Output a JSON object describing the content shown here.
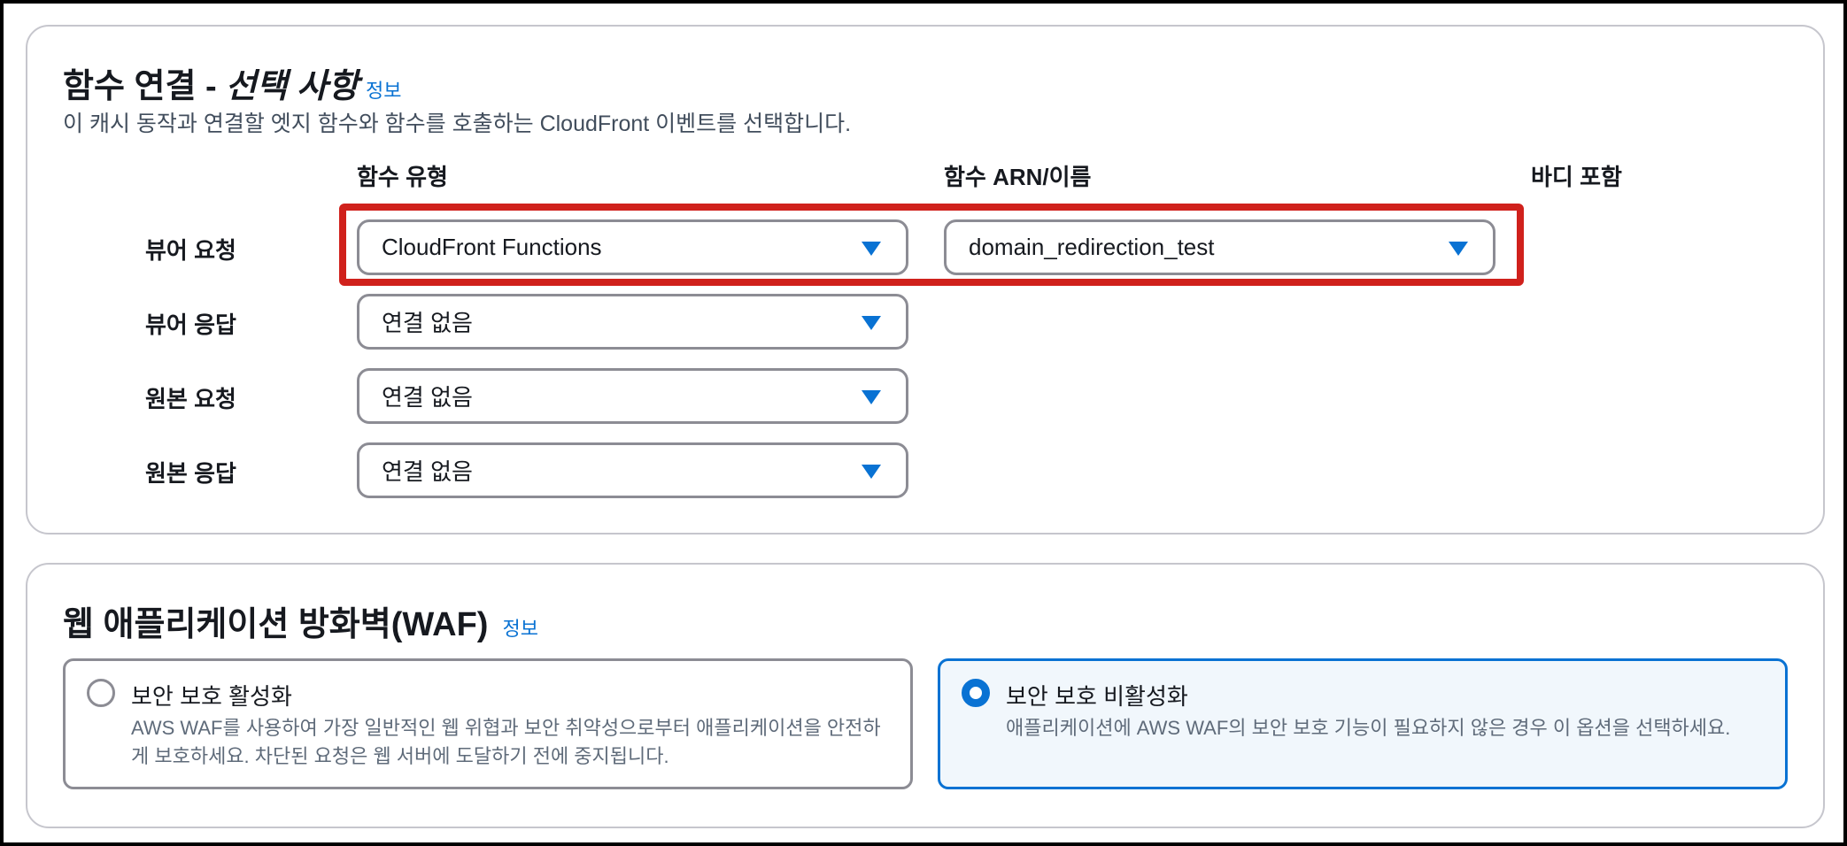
{
  "functions": {
    "title": "함수 연결 - ",
    "title_italic": "선택 사항",
    "info": "정보",
    "description": "이 캐시 동작과 연결할 엣지 함수와 함수를 호출하는 CloudFront 이벤트를 선택합니다.",
    "columns": {
      "type": "함수 유형",
      "arn": "함수 ARN/이름",
      "body": "바디 포함"
    },
    "rows": [
      {
        "label": "뷰어 요청",
        "type_value": "CloudFront Functions",
        "arn_value": "domain_redirection_test"
      },
      {
        "label": "뷰어 응답",
        "type_value": "연결 없음"
      },
      {
        "label": "원본 요청",
        "type_value": "연결 없음"
      },
      {
        "label": "원본 응답",
        "type_value": "연결 없음"
      }
    ]
  },
  "waf": {
    "title": "웹 애플리케이션 방화벽(WAF)",
    "info": "정보",
    "options": [
      {
        "title": "보안 보호 활성화",
        "description": "AWS WAF를 사용하여 가장 일반적인 웹 위협과 보안 취약성으로부터 애플리케이션을 안전하게 보호하세요. 차단된 요청은 웹 서버에 도달하기 전에 중지됩니다.",
        "selected": false
      },
      {
        "title": "보안 보호 비활성화",
        "description": "애플리케이션에 AWS WAF의 보안 보호 기능이 필요하지 않은 경우 이 옵션을 선택하세요.",
        "selected": true
      }
    ]
  },
  "colors": {
    "accent": "#0972d3",
    "highlight": "#d0211c",
    "border": "#8c8c94"
  },
  "icons": {
    "dropdown": "caret-down-icon",
    "radio": "radio-icon"
  }
}
